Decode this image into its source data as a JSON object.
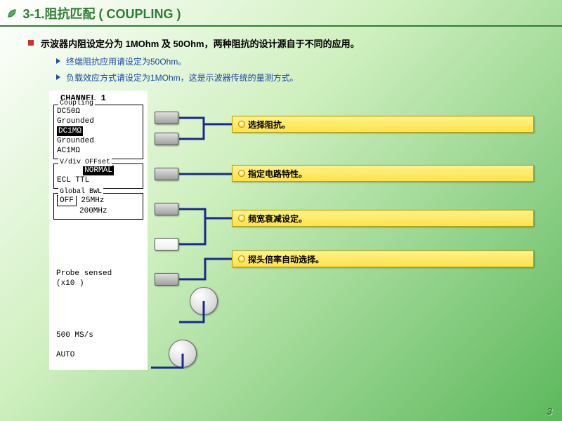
{
  "title": "3-1.阻抗匹配 ( COUPLING )",
  "main_bullet": "示波器内阻设定分为 1MOhm 及 50Ohm，两种阻抗的设计源自于不同的应用。",
  "sub_bullets": [
    "终端阻抗应用请设定为50Ohm。",
    "负载效应方式请设定为1MOhm，这是示波器传统的量测方式。"
  ],
  "panel": {
    "channel": "CHANNEL 1",
    "coupling": {
      "label": "Coupling",
      "items": [
        "DC50Ω",
        "Grounded",
        "DC1MΩ",
        "Grounded",
        "AC1MΩ"
      ],
      "selected_index": 2
    },
    "vdiv": {
      "label": "V/div OFFset",
      "normal": "NORMAL",
      "items": "ECL  TTL"
    },
    "bwl": {
      "label": "Global BWL",
      "off": "OFF",
      "opts": "25MHz",
      "opt2": "200MHz"
    },
    "probe": {
      "l1": "Probe sensed",
      "l2": "(x10      )"
    },
    "rate": "500 MS/s",
    "mode": "AUTO"
  },
  "bars": [
    "选择阻抗。",
    "指定电路特性。",
    "频宽衰减设定。",
    "探头倍率自动选择。"
  ],
  "page_number": "3"
}
